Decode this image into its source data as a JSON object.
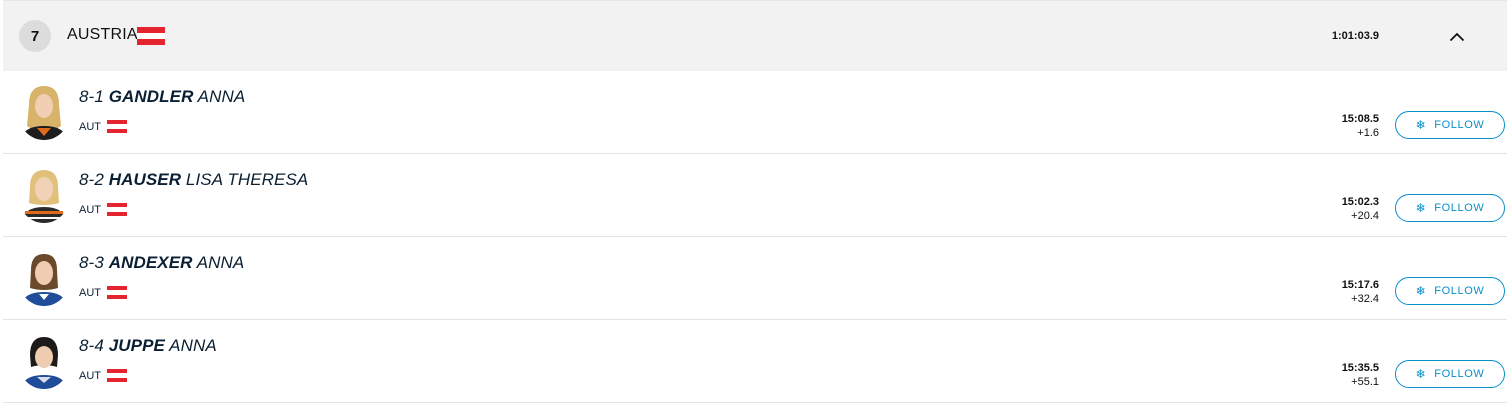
{
  "team": {
    "rank": "7",
    "name": "AUSTRIA",
    "time": "1:01:03.9"
  },
  "athletes": [
    {
      "bib": "8-1",
      "last_name": "GANDLER",
      "first_name": "ANNA",
      "nation": "AUT",
      "time": "15:08.5",
      "diff": "+1.6",
      "follow_label": "FOLLOW"
    },
    {
      "bib": "8-2",
      "last_name": "HAUSER",
      "first_name": "LISA THERESA",
      "nation": "AUT",
      "time": "15:02.3",
      "diff": "+20.4",
      "follow_label": "FOLLOW"
    },
    {
      "bib": "8-3",
      "last_name": "ANDEXER",
      "first_name": "ANNA",
      "nation": "AUT",
      "time": "15:17.6",
      "diff": "+32.4",
      "follow_label": "FOLLOW"
    },
    {
      "bib": "8-4",
      "last_name": "JUPPE",
      "first_name": "ANNA",
      "nation": "AUT",
      "time": "15:35.5",
      "diff": "+55.1",
      "follow_label": "FOLLOW"
    }
  ],
  "icons": {
    "collapse": "chevron-up-icon",
    "follow": "snowflake-icon",
    "flag": "austria-flag-icon"
  },
  "colors": {
    "accent": "#0a8ec8",
    "flag_red": "#e4242f",
    "header_bg": "#f2f2f2"
  }
}
